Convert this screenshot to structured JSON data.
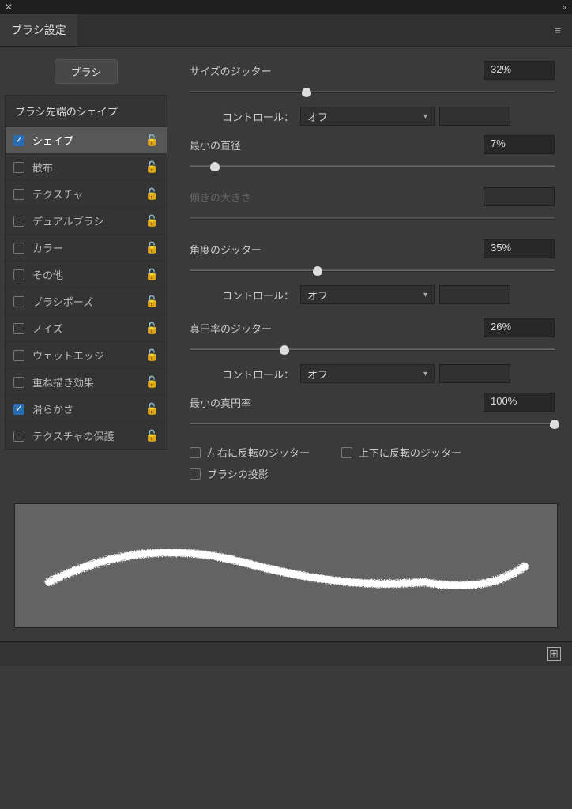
{
  "tab": "ブラシ設定",
  "brushButton": "ブラシ",
  "list": {
    "header": "ブラシ先端のシェイプ",
    "items": [
      {
        "label": "シェイプ",
        "checked": true,
        "selected": true
      },
      {
        "label": "散布",
        "checked": false
      },
      {
        "label": "テクスチャ",
        "checked": false
      },
      {
        "label": "デュアルブラシ",
        "checked": false
      },
      {
        "label": "カラー",
        "checked": false
      },
      {
        "label": "その他",
        "checked": false
      },
      {
        "label": "ブラシポーズ",
        "checked": false
      },
      {
        "label": "ノイズ",
        "checked": false
      },
      {
        "label": "ウェットエッジ",
        "checked": false
      },
      {
        "label": "重ね描き効果",
        "checked": false
      },
      {
        "label": "滑らかさ",
        "checked": true
      },
      {
        "label": "テクスチャの保護",
        "checked": false
      }
    ]
  },
  "settings": {
    "sizeJitter": {
      "label": "サイズのジッター",
      "value": "32%",
      "pos": 32
    },
    "control1": {
      "label": "コントロール：",
      "value": "オフ"
    },
    "minDiameter": {
      "label": "最小の直径",
      "value": "7%",
      "pos": 7
    },
    "tiltScale": {
      "label": "傾きの大きさ",
      "value": "",
      "disabled": true
    },
    "angleJitter": {
      "label": "角度のジッター",
      "value": "35%",
      "pos": 35
    },
    "control2": {
      "label": "コントロール：",
      "value": "オフ"
    },
    "roundJitter": {
      "label": "真円率のジッター",
      "value": "26%",
      "pos": 26
    },
    "control3": {
      "label": "コントロール：",
      "value": "オフ"
    },
    "minRound": {
      "label": "最小の真円率",
      "value": "100%",
      "pos": 100
    },
    "flipX": "左右に反転のジッター",
    "flipY": "上下に反転のジッター",
    "projection": "ブラシの投影"
  }
}
